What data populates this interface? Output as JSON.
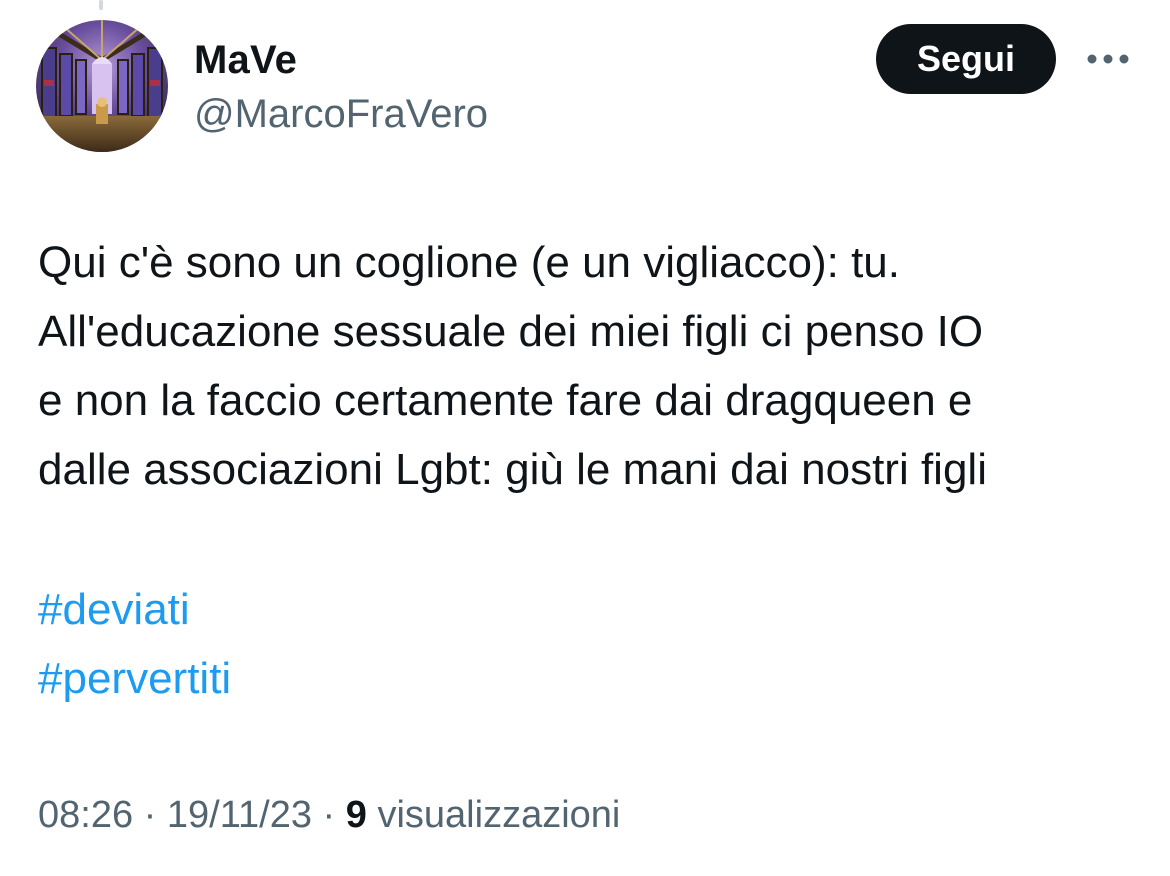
{
  "tweet": {
    "author": {
      "display_name": "MaVe",
      "handle": "@MarcoFraVero",
      "avatar_icon": "cathedral-stained-glass-avatar"
    },
    "follow_label": "Segui",
    "more_icon": "ellipsis-icon",
    "text": "Qui c'è sono un coglione (e un vigliacco): tu.\nAll'educazione sessuale dei miei figli ci penso IO\ne non la faccio certamente fare dai dragqueen e\ndalle associazioni Lgbt: giù le mani dai nostri figli",
    "hashtags": [
      "#deviati",
      "#pervertiti"
    ],
    "time": "08:26",
    "separator": " · ",
    "date": "19/11/23",
    "views_count": "9",
    "views_label": "visualizzazioni"
  },
  "colors": {
    "text": "#0f1419",
    "secondary_text": "#536471",
    "link": "#1d9bf0",
    "button_bg": "#0f1419",
    "button_text": "#ffffff"
  }
}
